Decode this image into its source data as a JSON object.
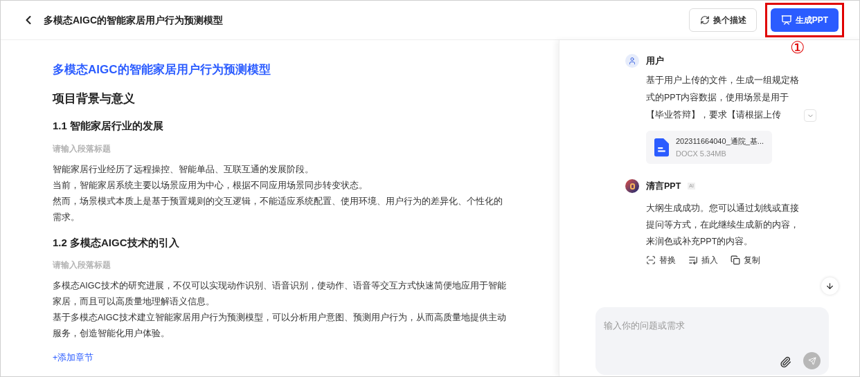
{
  "header": {
    "title": "多模态AIGC的智能家居用户行为预测模型",
    "buttons": [
      {
        "label": "换个描述",
        "kind": "secondary"
      },
      {
        "label": "生成PPT",
        "kind": "primary"
      }
    ],
    "annotation": "①"
  },
  "document": {
    "title": "多模态AIGC的智能家居用户行为预测模型",
    "section": "项目背景与意义",
    "chapters": [
      {
        "heading": "1.1 智能家居行业的发展",
        "placeholder": "请输入段落标题",
        "lines": [
          "智能家居行业经历了远程操控、智能单品、互联互通的发展阶段。",
          "当前，智能家居系统主要以场景应用为中心，根据不同应用场景同步转变状态。",
          "然而，场景模式本质上是基于预置规则的交互逻辑，不能适应系统配置、使用环境、用户行为的差异化、个性化的需求。"
        ]
      },
      {
        "heading": "1.2 多模态AIGC技术的引入",
        "placeholder": "请输入段落标题",
        "lines": [
          "多模态AIGC技术的研究进展，不仅可以实现动作识别、语音识别，使动作、语音等交互方式快速简便地应用于智能家居，而且可以高质量地理解语义信息。",
          "基于多模态AIGC技术建立智能家居用户行为预测模型，可以分析用户意图、预测用户行为，从而高质量地提供主动服务，创造智能化用户体验。"
        ]
      }
    ],
    "add_chapter": "+添加章节"
  },
  "chat": {
    "messages": [
      {
        "kind": "user",
        "sender": "用户",
        "text": "基于用户上传的文件，生成一组规定格式的PPT内容数据，使用场景是用于【毕业答辩】，要求【请根据上传",
        "file": {
          "name": "202311664040_通院_基...",
          "type": "DOCX",
          "size": "5.34MB"
        }
      },
      {
        "kind": "bot",
        "sender": "清言PPT",
        "badge": "AI",
        "text": "大纲生成成功。您可以通过划线或直接提问等方式，在此继续生成新的内容，来润色或补充PPT的内容。",
        "actions": [
          {
            "label": "替换",
            "kind": "replace"
          },
          {
            "label": "插入",
            "kind": "insert"
          },
          {
            "label": "复制",
            "kind": "copy"
          }
        ]
      }
    ],
    "input": {
      "placeholder": "输入你的问题或需求"
    }
  }
}
